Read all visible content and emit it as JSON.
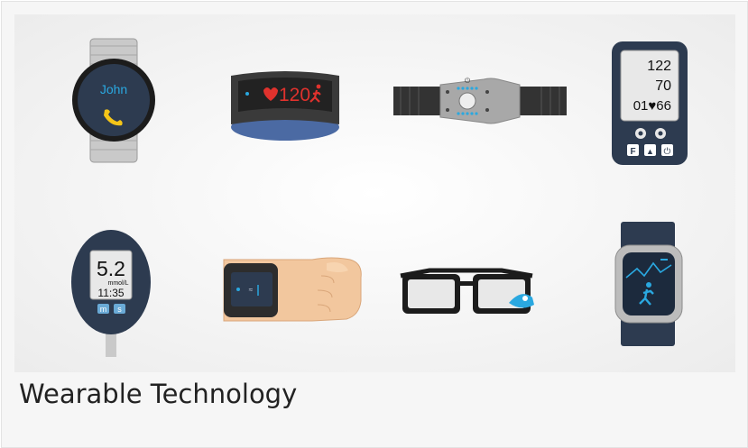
{
  "caption": "Wearable Technology",
  "devices": {
    "smartwatch": {
      "name": "John",
      "icon": "phone-icon"
    },
    "fitness_band": {
      "value": "120",
      "icons": [
        "heart-icon",
        "running-person-icon"
      ]
    },
    "bp_monitor": {
      "systolic": "122",
      "diastolic": "70",
      "pulse": "01♥66",
      "buttons": [
        "F",
        "▲",
        "⏻"
      ]
    },
    "glucose_meter": {
      "value": "5.2",
      "unit": "mmol/L",
      "time": "11:35",
      "buttons": [
        "m",
        "s"
      ]
    }
  },
  "colors": {
    "background": "#f6f6f6",
    "accent": "#2aa8e0",
    "heart": "#e0322d",
    "caption": "#222222"
  }
}
